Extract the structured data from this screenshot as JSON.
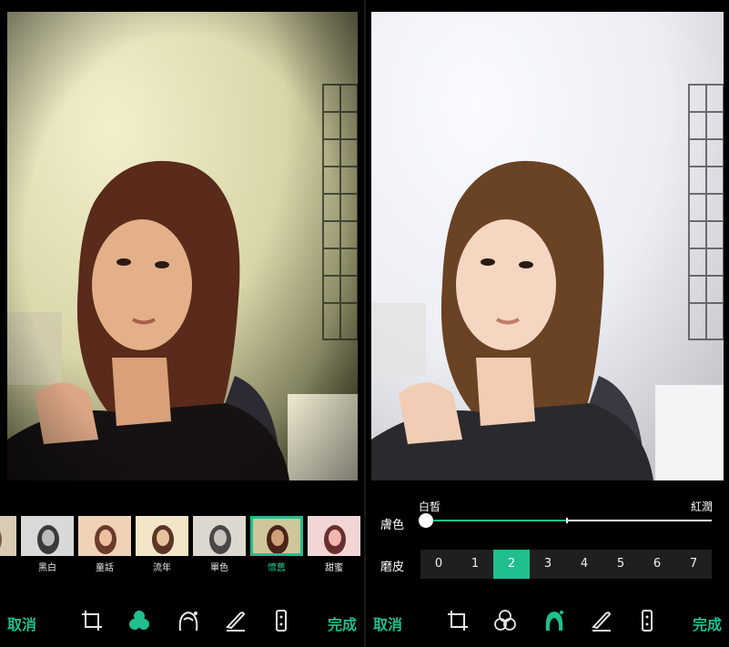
{
  "left_panel": {
    "filters": [
      {
        "label": "",
        "active": false,
        "tone": "#c9b8a0"
      },
      {
        "label": "黑白",
        "active": false,
        "tone": "#9a9a9a"
      },
      {
        "label": "童話",
        "active": false,
        "tone": "#e2b7a0"
      },
      {
        "label": "流年",
        "active": false,
        "tone": "#e8d0b0"
      },
      {
        "label": "單色",
        "active": false,
        "tone": "#bdb8b0"
      },
      {
        "label": "懷舊",
        "active": true,
        "tone": "#b08a5a"
      },
      {
        "label": "甜蜜",
        "active": false,
        "tone": "#e8b0b8"
      }
    ],
    "toolbar": {
      "cancel": "取消",
      "done": "完成",
      "active_tool": "filter"
    }
  },
  "right_panel": {
    "skin": {
      "label": "膚色",
      "min_label": "白皙",
      "max_label": "紅潤",
      "value_fraction": 0.0,
      "midpoint_fraction": 0.49
    },
    "smoothing": {
      "label": "磨皮",
      "levels": [
        "0",
        "1",
        "2",
        "3",
        "4",
        "5",
        "6",
        "7"
      ],
      "selected": "2"
    },
    "toolbar": {
      "cancel": "取消",
      "done": "完成",
      "active_tool": "beauty"
    }
  },
  "colors": {
    "accent": "#1fbf8f",
    "background": "#000000"
  },
  "icons": [
    "crop-icon",
    "filter-icon",
    "beauty-icon",
    "brush-icon",
    "adjust-icon"
  ]
}
